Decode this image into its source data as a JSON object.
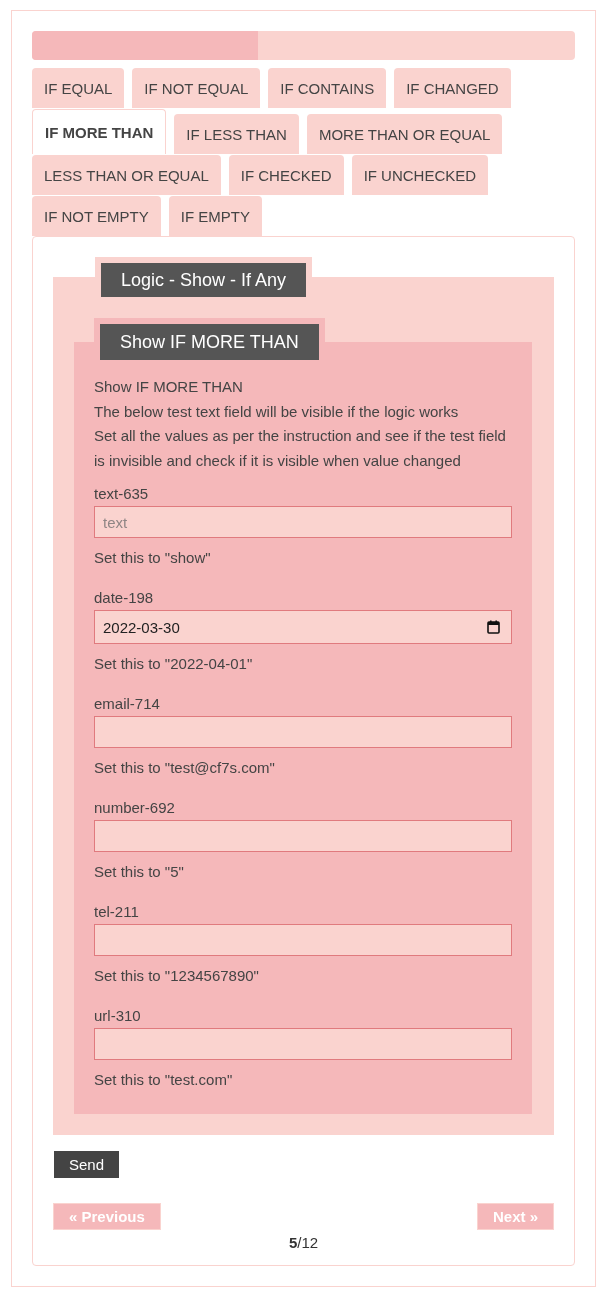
{
  "progress": {
    "level": 0.416
  },
  "tabs": [
    {
      "label": "IF EQUAL",
      "selected": false
    },
    {
      "label": "IF NOT EQUAL",
      "selected": false
    },
    {
      "label": "IF CONTAINS",
      "selected": false
    },
    {
      "label": "IF CHANGED",
      "selected": false
    },
    {
      "label": "IF MORE THAN",
      "selected": true
    },
    {
      "label": "IF LESS THAN",
      "selected": false
    },
    {
      "label": "MORE THAN OR EQUAL",
      "selected": false
    },
    {
      "label": "LESS THAN OR EQUAL",
      "selected": false
    },
    {
      "label": "IF CHECKED",
      "selected": false
    },
    {
      "label": "IF UNCHECKED",
      "selected": false
    },
    {
      "label": "IF NOT EMPTY",
      "selected": false
    },
    {
      "label": "IF EMPTY",
      "selected": false
    }
  ],
  "form": {
    "title": "Logic - Show - If Any",
    "group": {
      "title": "Show IF MORE THAN",
      "intro": [
        "Show IF MORE THAN",
        "The below test text field will be visible if the logic works",
        "Set all the values as per the instruction and see if the test field is invisible and check if it is visible when value changed"
      ],
      "fields": [
        {
          "label": "text-635",
          "kind": "text",
          "placeholder": "text",
          "hint": "Set this to \"show\""
        },
        {
          "label": "date-198",
          "kind": "date",
          "value": "2022-03-30",
          "hint": "Set this to \"2022-04-01\""
        },
        {
          "label": "email-714",
          "kind": "text",
          "hint": "Set this to \"test@cf7s.com\""
        },
        {
          "label": "number-692",
          "kind": "text",
          "hint": "Set this to \"5\""
        },
        {
          "label": "tel-211",
          "kind": "text",
          "hint": "Set this to \"1234567890\""
        },
        {
          "label": "url-310",
          "kind": "text",
          "hint": "Set this to \"test.com\""
        }
      ]
    }
  },
  "submit": "Send",
  "pager": {
    "previous": "« Previous",
    "next": "Next »",
    "counter": "**5**/12"
  }
}
